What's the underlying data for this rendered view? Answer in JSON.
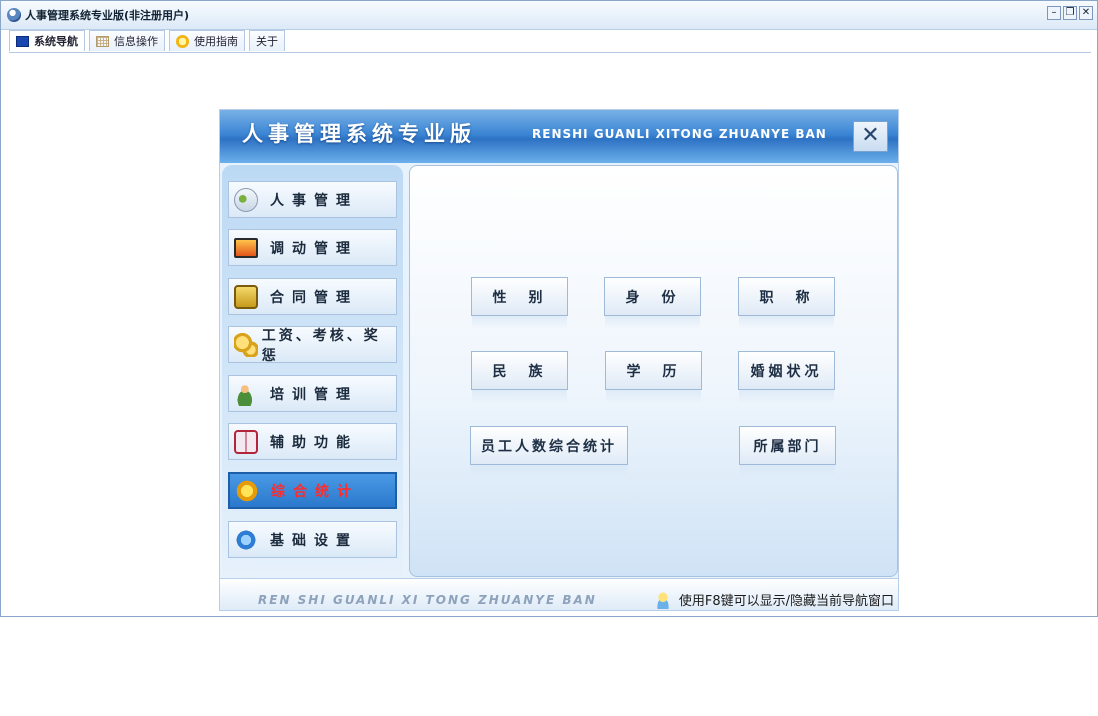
{
  "window": {
    "title": "人事管理系统专业版(非注册用户)",
    "controls": {
      "minimize": "–",
      "restore": "❐",
      "close": "✕"
    }
  },
  "tabs": [
    {
      "label": "系统导航",
      "icon": "monitor-icon",
      "active": true
    },
    {
      "label": "信息操作",
      "icon": "grid-icon",
      "active": false
    },
    {
      "label": "使用指南",
      "icon": "guide-icon",
      "active": false
    },
    {
      "label": "关于",
      "icon": "",
      "active": false
    }
  ],
  "panel": {
    "title": "人事管理系统专业版",
    "title_en": "RENSHI GUANLI XITONG ZHUANYE BAN",
    "close_label": "✕",
    "nav_items": [
      {
        "label": "人事管理",
        "icon": "person-card-icon",
        "active": false
      },
      {
        "label": "调动管理",
        "icon": "monitor-icon",
        "active": false
      },
      {
        "label": "合同管理",
        "icon": "document-icon",
        "active": false
      },
      {
        "label": "工资、考核、奖惩",
        "icon": "coins-icon",
        "active": false
      },
      {
        "label": "培训管理",
        "icon": "trainee-icon",
        "active": false
      },
      {
        "label": "辅助功能",
        "icon": "book-icon",
        "active": false
      },
      {
        "label": "综合统计",
        "icon": "star-icon",
        "active": true
      },
      {
        "label": "基础设置",
        "icon": "settings-star-icon",
        "active": false
      }
    ],
    "buttons": [
      {
        "label": "性　别"
      },
      {
        "label": "身　份"
      },
      {
        "label": "职　称"
      },
      {
        "label": "民　族"
      },
      {
        "label": "学　历"
      },
      {
        "label": "婚姻状况"
      },
      {
        "label": "员工人数综合统计"
      },
      {
        "label": "所属部门"
      }
    ],
    "footer_en": "REN SHI GUANLI XI TONG ZHUANYE BAN",
    "footer_hint": "使用F8键可以显示/隐藏当前导航窗口"
  }
}
